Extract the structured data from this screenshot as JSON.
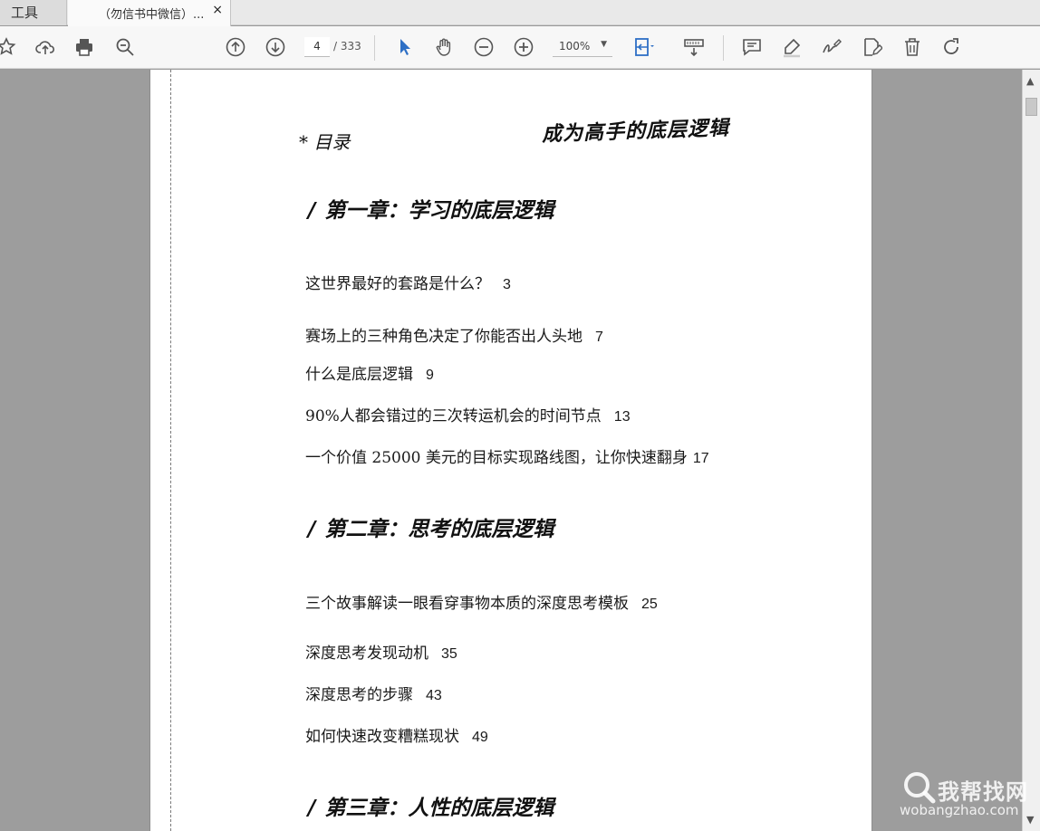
{
  "tabs": {
    "tools_label": "工具",
    "document_title": "（勿信书中微信）...",
    "close_symbol": "×"
  },
  "toolbar": {
    "icons": [
      "bookmark-star-icon",
      "upload-cloud-icon",
      "print-icon",
      "search-zoom-icon",
      "prev-page-icon",
      "next-page-icon",
      "select-cursor-icon",
      "hand-tool-icon",
      "zoom-out-icon",
      "zoom-in-icon",
      "fit-page-icon",
      "scroll-mode-icon",
      "comment-icon",
      "highlight-icon",
      "sign-icon",
      "edit-icon",
      "delete-icon",
      "rotate-icon"
    ],
    "current_page": "4",
    "total_pages": "/ 333",
    "zoom": "100%"
  },
  "document": {
    "toc_heading": "* 目录",
    "book_title": "成为高手的底层逻辑",
    "chapters": [
      {
        "title": "第一章：学习的底层逻辑",
        "entries": [
          {
            "text": "这世界最好的套路是什么？",
            "page": "3"
          },
          {
            "text": "赛场上的三种角色决定了你能否出人头地",
            "page": "7"
          },
          {
            "text": "什么是底层逻辑",
            "page": "9"
          },
          {
            "text": "90%人都会错过的三次转运机会的时间节点",
            "page": "13"
          },
          {
            "text": "一个价值 25000 美元的目标实现路线图，让你快速翻身",
            "page": "17"
          }
        ]
      },
      {
        "title": "第二章：思考的底层逻辑",
        "entries": [
          {
            "text": "三个故事解读一眼看穿事物本质的深度思考模板",
            "page": "25"
          },
          {
            "text": "深度思考发现动机",
            "page": "35"
          },
          {
            "text": "深度思考的步骤",
            "page": "43"
          },
          {
            "text": "如何快速改变糟糕现状",
            "page": "49"
          }
        ]
      },
      {
        "title": "第三章：人性的底层逻辑",
        "entries": []
      }
    ]
  },
  "watermark": {
    "main": "我帮找网",
    "sub": "wobangzhao.com"
  }
}
